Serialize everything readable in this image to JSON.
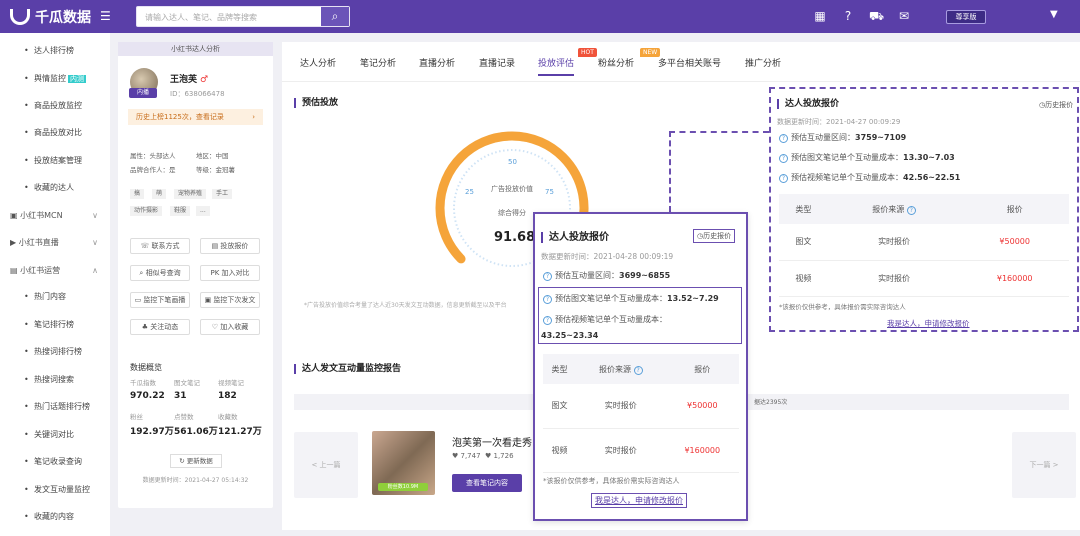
{
  "topbar": {
    "logo": "千瓜数据",
    "search_placeholder": "请输入达人、笔记、品牌等搜索",
    "vip": "尊享版"
  },
  "sidebar": {
    "items": [
      {
        "label": "达人排行榜",
        "type": "sub"
      },
      {
        "label": "舆情监控",
        "type": "sub",
        "badge": "内测"
      },
      {
        "label": "商品投放监控",
        "type": "sub"
      },
      {
        "label": "商品投放对比",
        "type": "sub"
      },
      {
        "label": "投放结案管理",
        "type": "sub"
      },
      {
        "label": "收藏的达人",
        "type": "sub"
      },
      {
        "label": "小红书MCN",
        "type": "grp"
      },
      {
        "label": "小红书直播",
        "type": "grp"
      },
      {
        "label": "小红书运营",
        "type": "grp"
      },
      {
        "label": "热门内容",
        "type": "sub"
      },
      {
        "label": "笔记排行榜",
        "type": "sub"
      },
      {
        "label": "热搜词排行榜",
        "type": "sub"
      },
      {
        "label": "热搜词搜索",
        "type": "sub"
      },
      {
        "label": "热门话题排行榜",
        "type": "sub"
      },
      {
        "label": "关键词对比",
        "type": "sub"
      },
      {
        "label": "笔记收录查询",
        "type": "sub"
      },
      {
        "label": "发文互动量监控",
        "type": "sub"
      },
      {
        "label": "收藏的内容",
        "type": "sub"
      }
    ]
  },
  "profile": {
    "header": "小红书达人分析",
    "avatar_tag": "内播",
    "name": "王泡芙",
    "id": "ID：638066478",
    "history": "历史上榜1125次，查看记录",
    "attr_type": "属性：头部达人",
    "attr_region": "地区：中国",
    "attr_brand": "品牌合作人：是",
    "attr_level": "等级：金冠薯",
    "tags": [
      "搞",
      "萌",
      "宠物养殖",
      "手工",
      "动作摄影",
      "鞋服",
      "..."
    ],
    "buttons": [
      "联系方式",
      "投放报价",
      "相似号查询",
      "加入对比",
      "监控下笔画播",
      "监控下次发文",
      "关注动态",
      "加入收藏"
    ],
    "data_title": "数据概览",
    "stats": [
      {
        "label": "千瓜指数",
        "value": "970.22"
      },
      {
        "label": "图文笔记",
        "value": "31"
      },
      {
        "label": "视频笔记",
        "value": "182"
      },
      {
        "label": "粉丝",
        "value": "192.97万"
      },
      {
        "label": "点赞数",
        "value": "561.06万"
      },
      {
        "label": "收藏数",
        "value": "121.27万"
      }
    ],
    "update_btn": "更新数据",
    "update_time": "数据更新时间：2021-04-27 05:14:32"
  },
  "tabs": [
    {
      "label": "达人分析"
    },
    {
      "label": "笔记分析"
    },
    {
      "label": "直播分析"
    },
    {
      "label": "直播记录"
    },
    {
      "label": "投放评估",
      "active": true,
      "badge": "HOT"
    },
    {
      "label": "粉丝分析",
      "badge": "NEW"
    },
    {
      "label": "多平台相关账号"
    },
    {
      "label": "推广分析"
    }
  ],
  "estimate": {
    "title": "预估投放",
    "gauge_value": 91.68,
    "gauge_max": 100,
    "gauge_ticks": [
      "25",
      "50",
      "75"
    ],
    "gauge_label1": "广告投放价值",
    "gauge_label2": "综合得分",
    "score": "91.68",
    "note": "*广告投放价值综合考量了达人近30天发文互动数据，信息更新截至以及平台"
  },
  "monitor": {
    "title": "达人发文互动量监控报告",
    "strip_text": "据达2395次",
    "prev": "< 上一篇",
    "next": "下一篇 >",
    "thumb_tag": "粉丝数10.9M",
    "video_title": "泡芙第一次看走秀",
    "likes": "♥ 7,747",
    "comments": "♥ 1,726",
    "view_btn": "查看笔记内容"
  },
  "quote_popup": {
    "title": "达人投放报价",
    "history": "历史报价",
    "update_time": "数据更新时间：2021-04-28 00:09:19",
    "interaction_label": "预估互动量区间：",
    "interaction_value": "3699~6855",
    "image_cost_label": "预估图文笔记单个互动量成本：",
    "image_cost_value": "13.52~7.29",
    "video_cost_label": "预估视频笔记单个互动量成本：",
    "video_cost_value": "43.25~23.34",
    "headers": [
      "类型",
      "报价来源",
      "报价"
    ],
    "rows": [
      {
        "type": "图文",
        "source": "实时报价",
        "price": "¥50000"
      },
      {
        "type": "视频",
        "source": "实时报价",
        "price": "¥160000"
      }
    ],
    "footnote": "*该报价仅供参考，具体报价需实际咨询达人",
    "link": "我是达人，申请修改报价"
  },
  "quote_dash": {
    "title": "达人投放报价",
    "history": "历史报价",
    "update_time": "数据更新时间：2021-04-27 00:09:29",
    "interaction_label": "预估互动量区间：",
    "interaction_value": "3759~7109",
    "image_cost_label": "预估图文笔记单个互动量成本：",
    "image_cost_value": "13.30~7.03",
    "video_cost_label": "预估视频笔记单个互动量成本：",
    "video_cost_value": "42.56~22.51",
    "headers": [
      "类型",
      "报价来源",
      "报价"
    ],
    "rows": [
      {
        "type": "图文",
        "source": "实时报价",
        "price": "¥50000"
      },
      {
        "type": "视频",
        "source": "实时报价",
        "price": "¥160000"
      }
    ],
    "footnote": "*该报价仅供参考，具体报价需实际咨询达人",
    "link": "我是达人，申请修改报价"
  },
  "colors": {
    "brand": "#5a3fa8",
    "gauge_start": "#f5a43a",
    "gauge_end": "#f6d154",
    "price": "#e33333"
  },
  "icons": {
    "logo": "qiangua-logo-icon",
    "menu": "hamburger-icon",
    "search": "search-icon"
  }
}
